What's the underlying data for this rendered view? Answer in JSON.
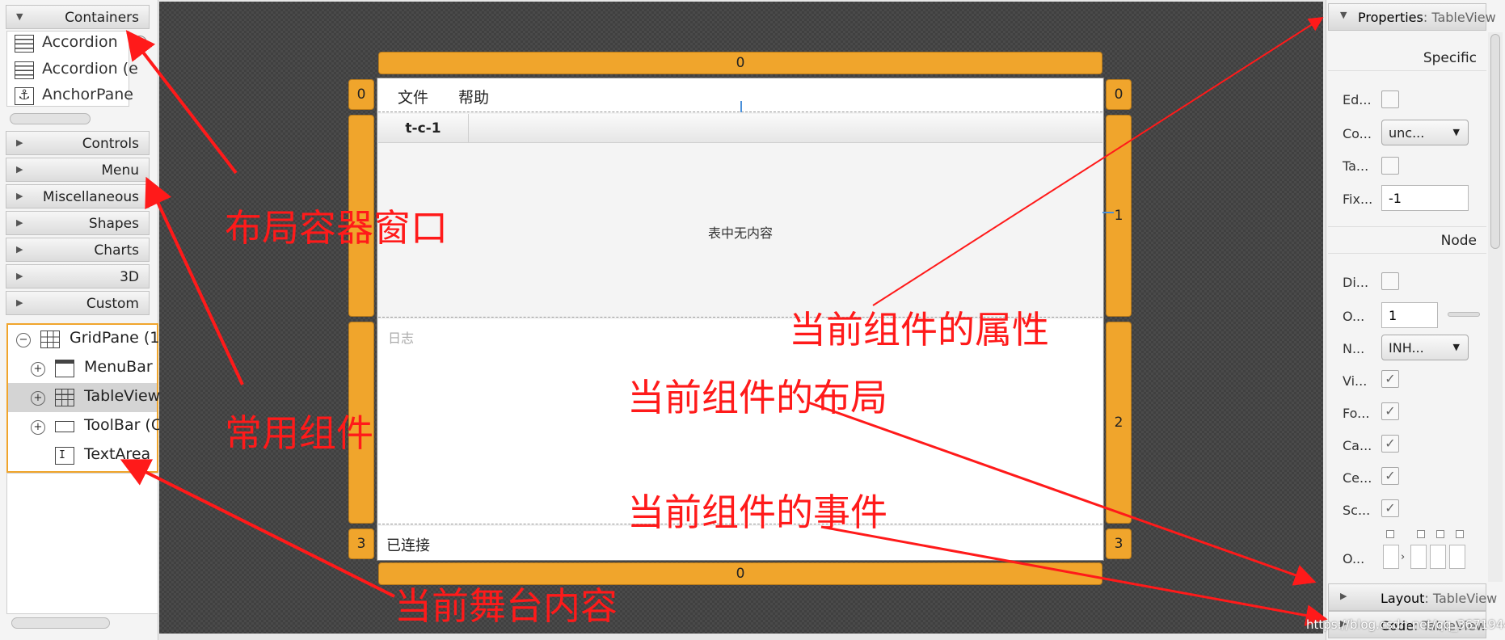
{
  "left_panel": {
    "sections": {
      "containers": "Containers",
      "controls": "Controls",
      "menu": "Menu",
      "miscellaneous": "Miscellaneous",
      "shapes": "Shapes",
      "charts": "Charts",
      "three_d": "3D",
      "custom": "Custom"
    },
    "container_items": [
      "Accordion",
      "Accordion  (e",
      "AnchorPane"
    ],
    "hierarchy": {
      "root": "GridPane (1",
      "children": [
        "MenuBar",
        "TableView",
        "ToolBar (C",
        "TextArea"
      ]
    }
  },
  "stage": {
    "col_top": "0",
    "col_bottom": "0",
    "row_left": [
      "0",
      "",
      "",
      "3"
    ],
    "row_right": [
      "0",
      "1",
      "2",
      "3"
    ],
    "menus": [
      "文件",
      "帮助"
    ],
    "table_column": "t-c-1",
    "table_placeholder": "表中无内容",
    "textarea_prompt": "日志",
    "status_text": "已连接"
  },
  "right_panel": {
    "properties_title": "Properties",
    "properties_sub": ": TableView",
    "specific": "Specific",
    "specific_props": {
      "editable": "Ed...",
      "column_resize": "Co...",
      "column_value": "unc...",
      "table_menu": "Ta...",
      "fixed_cell": "Fix...",
      "fixed_cell_value": "-1"
    },
    "node": "Node",
    "node_props": {
      "disable": "Di...",
      "opacity": "O...",
      "opacity_value": "1",
      "node_orientation": "N...",
      "node_orientation_value": "INH...",
      "visible": "Vi...",
      "focus_traversable": "Fo...",
      "cache": "Ca...",
      "center_shape": "Ce...",
      "scale_shape": "Sc...",
      "opaque_insets": "O..."
    },
    "layout_title": "Layout",
    "layout_sub": ": TableView",
    "code_title": "Code",
    "code_sub": ": TableView"
  },
  "annotations": {
    "layout_container": "布局容器窗口",
    "common_components": "常用组件",
    "stage_content": "当前舞台内容",
    "component_properties": "当前组件的属性",
    "component_layout": "当前组件的布局",
    "component_events": "当前组件的事件"
  },
  "watermark": "https://blog.csdn.net/qq_36719449",
  "colors": {
    "accent_orange": "#f0a52c",
    "annotation_red": "#ff1a1a",
    "canvas_dark": "#4a4a4a"
  }
}
